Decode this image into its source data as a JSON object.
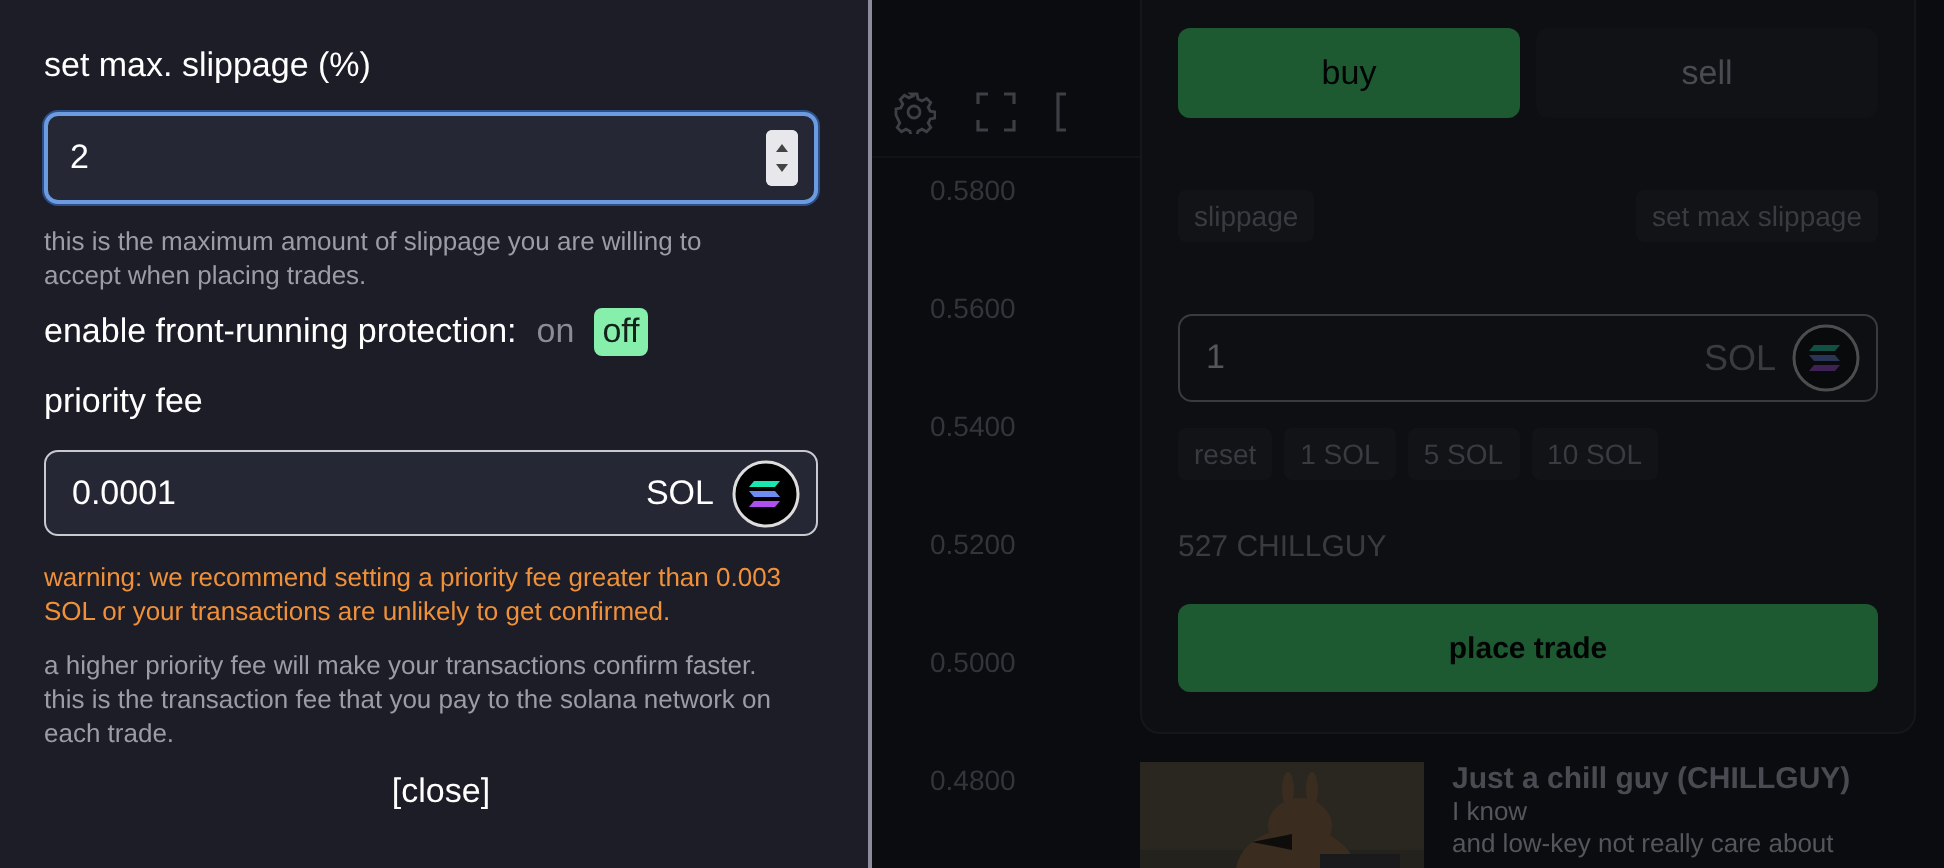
{
  "settings_panel": {
    "slippage": {
      "label": "set max. slippage (%)",
      "value": "2"
    },
    "slippage_help": "this is the maximum amount of slippage you are willing to accept when placing trades.",
    "front_running": {
      "label": "enable front-running protection:",
      "options": [
        {
          "label": "on",
          "selected": false
        },
        {
          "label": "off",
          "selected": true
        }
      ]
    },
    "priority_fee": {
      "label": "priority fee",
      "value": "0.0001",
      "unit": "SOL"
    },
    "warning": "warning: we recommend setting a priority fee greater than 0.003 SOL or your transactions are unlikely to get confirmed.",
    "priority_help": "a higher priority fee will make your transactions confirm faster. this is the transaction fee that you pay to the solana network on each trade.",
    "close_button": "[close]"
  },
  "chart": {
    "price_labels": [
      "0.5800",
      "0.5600",
      "0.5400",
      "0.5200",
      "0.5000",
      "0.4800"
    ]
  },
  "trade_panel": {
    "tabs": [
      {
        "label": "buy",
        "selected": true
      },
      {
        "label": "sell",
        "selected": false
      }
    ],
    "slippage_button": "slippage",
    "set_max_slippage_button": "set max slippage",
    "amount": {
      "value": "1",
      "unit": "SOL"
    },
    "quick_amounts": [
      "reset",
      "1 SOL",
      "5 SOL",
      "10 SOL"
    ],
    "balance": "527 CHILLGUY",
    "place_trade_button": "place trade"
  },
  "token_card": {
    "name": "Just a chill guy (CHILLGUY)",
    "description_lines": [
      "I know",
      "and low-key not really care about"
    ]
  }
}
